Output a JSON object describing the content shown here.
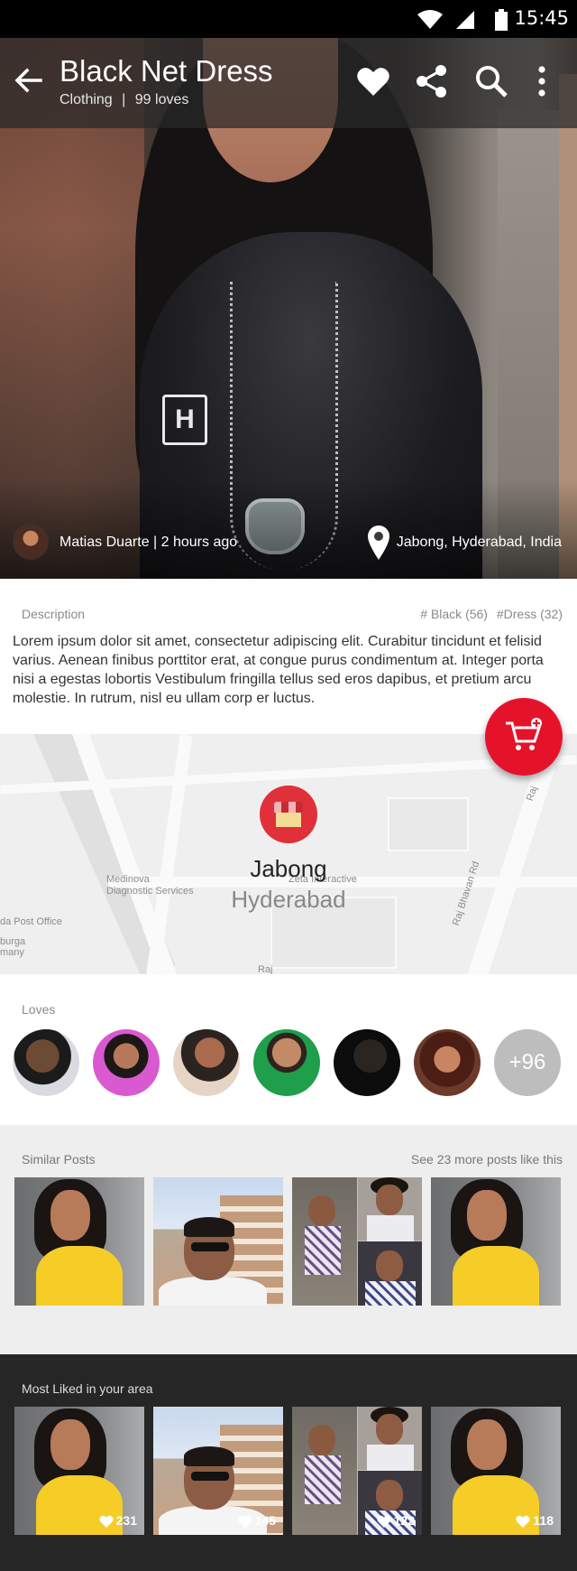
{
  "status_bar": {
    "time": "15:45"
  },
  "app_bar": {
    "title": "Black Net Dress",
    "category": "Clothing",
    "separator": "|",
    "loves": "99 loves"
  },
  "post": {
    "author_line": "Matias Duarte | 2 hours ago",
    "location": "Jabong, Hyderabad, India"
  },
  "description": {
    "heading": "Description",
    "tags": [
      "# Black (56)",
      "#Dress (32)"
    ],
    "body": "Lorem ipsum dolor sit amet, consectetur adipiscing elit. Curabitur tincidunt et felisid varius. Aenean finibus porttitor erat, at congue purus condimentum at. Integer porta nisi a egestas lobortis Vestibulum fringilla tellus sed eros dapibus, et pretium arcu molestie. In rutrum, nisl eu ullam corp er luctus."
  },
  "map": {
    "store_name": "Jabong",
    "city": "Hyderabad",
    "labels": [
      "Medinova",
      "Diagnostic Services",
      "Zeta Interactive",
      "da Post Office",
      "burga",
      "many",
      "Raj Bhavan Rd",
      "Raj",
      "Raj"
    ]
  },
  "loves": {
    "heading": "Loves",
    "more_count": "+96"
  },
  "similar_posts": {
    "heading": "Similar Posts",
    "see_more": "See 23 more posts like this"
  },
  "most_liked": {
    "heading": "Most Liked in your area",
    "counts": [
      "231",
      "145",
      "122",
      "118"
    ]
  },
  "colors": {
    "accent": "#e5132a",
    "map_pin": "#e0303a",
    "dark_section": "#262626",
    "light_section": "#eeeeee"
  },
  "icons": [
    "back-arrow-icon",
    "heart-icon",
    "share-icon",
    "search-icon",
    "more-vert-icon",
    "location-pin-icon",
    "add-to-cart-icon",
    "wifi-icon",
    "signal-icon",
    "battery-icon",
    "store-icon"
  ]
}
